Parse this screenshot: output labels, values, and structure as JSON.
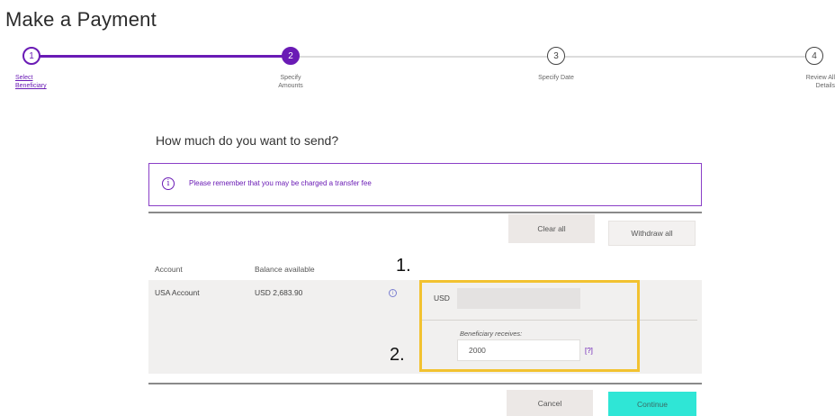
{
  "page": {
    "title": "Make a Payment"
  },
  "stepper": {
    "steps": [
      {
        "number": "1",
        "label": "Select Beneficiary",
        "state": "completed"
      },
      {
        "number": "2",
        "label": "Specify Amounts",
        "state": "active"
      },
      {
        "number": "3",
        "label": "Specify Date",
        "state": "upcoming"
      },
      {
        "number": "4",
        "label": "Review All Details",
        "state": "upcoming"
      }
    ],
    "colors": {
      "progress": "#6a1bb5",
      "track": "#d8d8d8"
    }
  },
  "form": {
    "question": "How much do you want to send?",
    "notice": {
      "icon": "info-icon",
      "text": "Please remember that you may be charged a transfer fee"
    },
    "clear_all_label": "Clear all",
    "withdraw_all_label": "Withdraw all",
    "table_headers": {
      "account": "Account",
      "balance": "Balance available"
    },
    "account": {
      "name": "USA Account",
      "balance": "USD 2,683.90",
      "currency": "USD",
      "amount_value": "",
      "beneficiary_label": "Beneficiary receives:",
      "beneficiary_value": "2000",
      "help_label": "[?]"
    },
    "cancel_label": "Cancel",
    "continue_label": "Continue"
  },
  "annotations": {
    "marker1": "1.",
    "marker2": "2.",
    "highlight_color": "#f2c230"
  },
  "colors": {
    "accent": "#6a1bb5",
    "primary_button": "#2fe6d6"
  }
}
